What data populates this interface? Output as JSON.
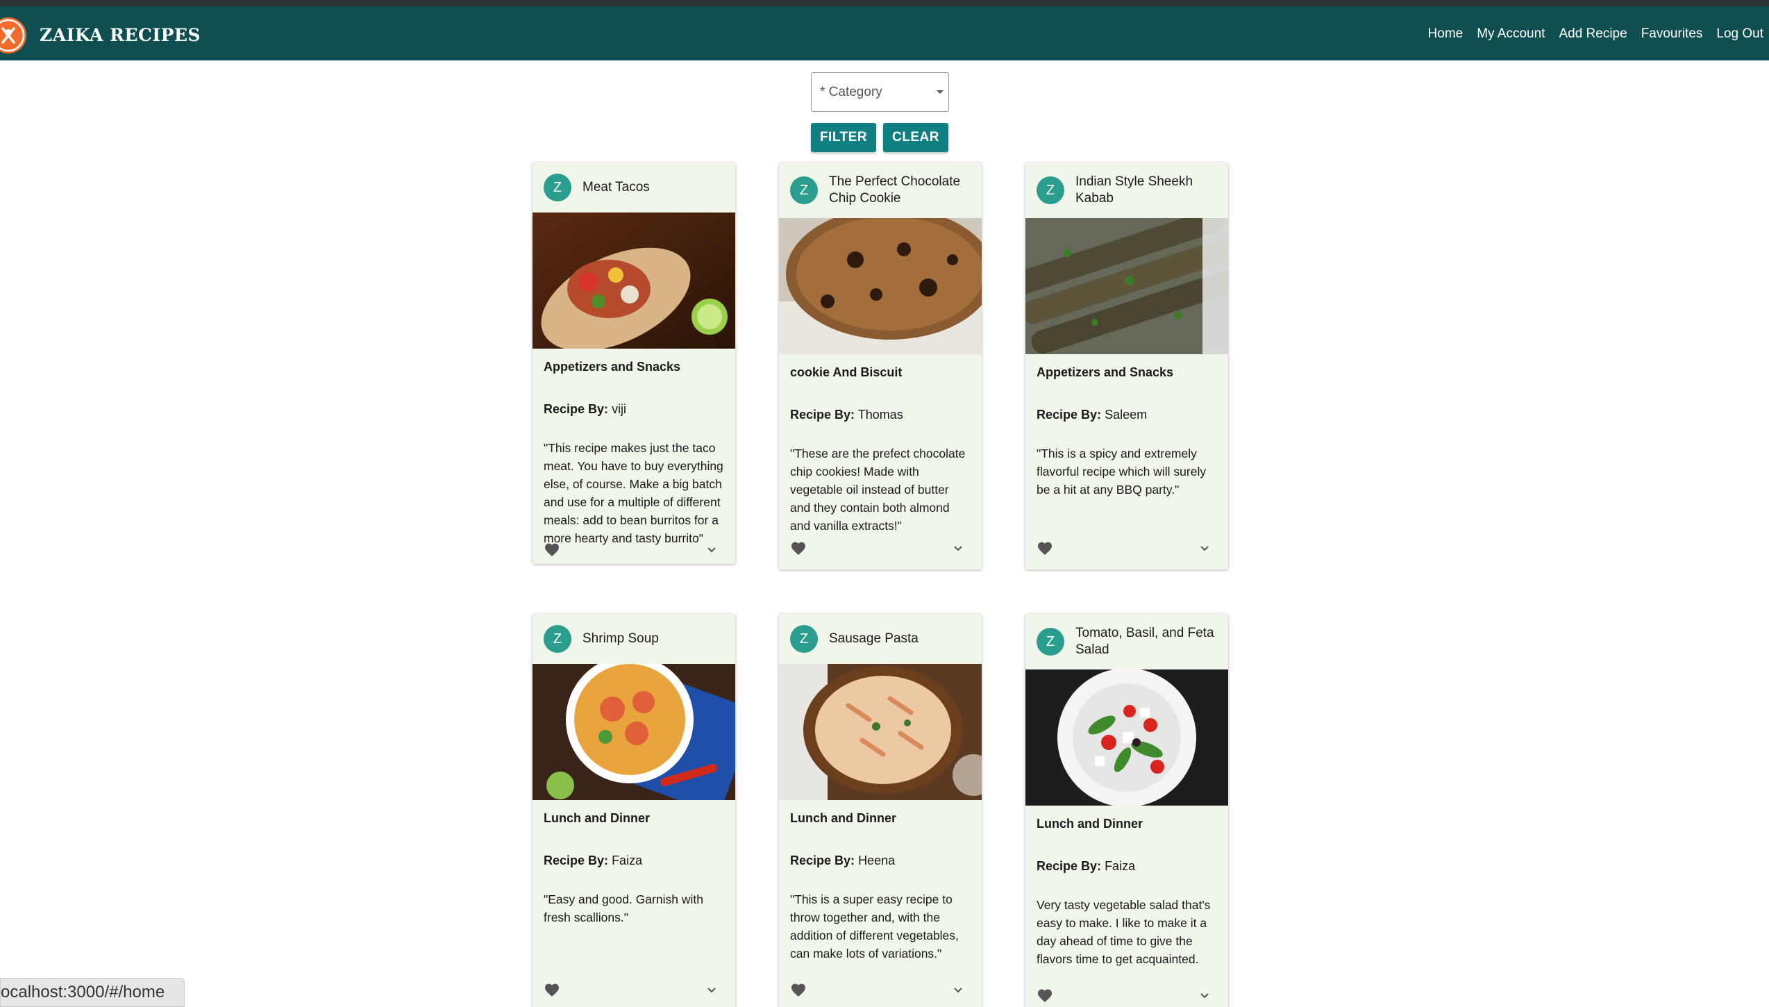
{
  "app": {
    "brand": "ZAIKA RECIPES",
    "logo_icon": "chef-utensils-icon"
  },
  "nav": [
    {
      "label": "Home"
    },
    {
      "label": "My Account"
    },
    {
      "label": "Add Recipe"
    },
    {
      "label": "Favourites"
    },
    {
      "label": "Log Out"
    }
  ],
  "filter": {
    "category_placeholder": "* Category",
    "filter_label": "FILTER",
    "clear_label": "CLEAR"
  },
  "cards": [
    {
      "avatar": "Z",
      "title": "Meat Tacos",
      "category": "Appetizers and Snacks",
      "by_label": "Recipe By:",
      "author": "viji",
      "description": "\"This recipe makes just the taco meat. You have to buy everything else, of course. Make a big batch and use for a multiple of different meals: add to bean burritos for a more hearty and tasty burrito\""
    },
    {
      "avatar": "Z",
      "title": "The Perfect Chocolate Chip Cookie",
      "category": "cookie And Biscuit",
      "by_label": "Recipe By:",
      "author": "Thomas",
      "description": "\"These are the prefect chocolate chip cookies! Made with vegetable oil instead of butter and they contain both almond and vanilla extracts!\""
    },
    {
      "avatar": "Z",
      "title": "Indian Style Sheekh Kabab",
      "category": "Appetizers and Snacks",
      "by_label": "Recipe By:",
      "author": "Saleem",
      "description": "\"This is a spicy and extremely flavorful recipe which will surely be a hit at any BBQ party.\""
    },
    {
      "avatar": "Z",
      "title": "Shrimp Soup",
      "category": "Lunch and Dinner",
      "by_label": "Recipe By:",
      "author": "Faiza",
      "description": "\"Easy and good. Garnish with fresh scallions.\""
    },
    {
      "avatar": "Z",
      "title": "Sausage Pasta",
      "category": "Lunch and Dinner",
      "by_label": "Recipe By:",
      "author": "Heena",
      "description": "\"This is a super easy recipe to throw together and, with the addition of different vegetables, can make lots of variations.\""
    },
    {
      "avatar": "Z",
      "title": "Tomato, Basil, and Feta Salad",
      "category": "Lunch and Dinner",
      "by_label": "Recipe By:",
      "author": "Faiza",
      "description": "Very tasty vegetable salad that's easy to make. I like to make it a day ahead of time to give the flavors time to get acquainted."
    }
  ],
  "status_bar": {
    "url": "ocalhost:3000/#/home"
  },
  "colors": {
    "navbar": "#0f4f52",
    "button": "#107f82",
    "card": "#f1f6ea",
    "avatar": "#2a9d8f",
    "logo": "#f26b2a"
  }
}
